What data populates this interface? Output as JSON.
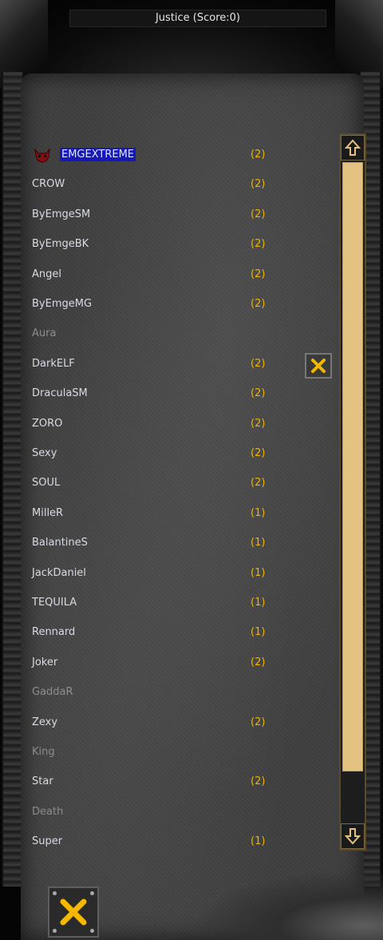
{
  "window": {
    "title": "Justice (Score:0)"
  },
  "players": [
    {
      "name": "EMGEXTREME",
      "count": "(2)",
      "selected": true,
      "active": true
    },
    {
      "name": "CROW",
      "count": "(2)",
      "active": true
    },
    {
      "name": "ByEmgeSM",
      "count": "(2)",
      "active": true
    },
    {
      "name": "ByEmgeBK",
      "count": "(2)",
      "active": true
    },
    {
      "name": "Angel",
      "count": "(2)",
      "active": true
    },
    {
      "name": "ByEmgeMG",
      "count": "(2)",
      "active": true
    },
    {
      "name": "Aura",
      "count": "",
      "active": false
    },
    {
      "name": "DarkELF",
      "count": "(2)",
      "active": true
    },
    {
      "name": "DraculaSM",
      "count": "(2)",
      "active": true
    },
    {
      "name": "ZORO",
      "count": "(2)",
      "active": true
    },
    {
      "name": "Sexy",
      "count": "(2)",
      "active": true
    },
    {
      "name": "SOUL",
      "count": "(2)",
      "active": true
    },
    {
      "name": "MilleR",
      "count": "(1)",
      "active": true
    },
    {
      "name": "BalantineS",
      "count": "(1)",
      "active": true
    },
    {
      "name": "JackDaniel",
      "count": "(1)",
      "active": true
    },
    {
      "name": "TEQUILA",
      "count": "(1)",
      "active": true
    },
    {
      "name": "Rennard",
      "count": "(1)",
      "active": true
    },
    {
      "name": "Joker",
      "count": "(2)",
      "active": true
    },
    {
      "name": "GaddaR",
      "count": "",
      "active": false
    },
    {
      "name": "Zexy",
      "count": "(2)",
      "active": true
    },
    {
      "name": "King",
      "count": "",
      "active": false
    },
    {
      "name": "Star",
      "count": "(2)",
      "active": true
    },
    {
      "name": "Death",
      "count": "",
      "active": false
    },
    {
      "name": "Super",
      "count": "(1)",
      "active": true
    }
  ],
  "icons": {
    "selected_player": "devil-icon",
    "scroll_up": "arrow-up-icon",
    "scroll_down": "arrow-down-icon",
    "close": "close-icon"
  },
  "colors": {
    "name_text": "#d8dbe3",
    "inactive_text": "#8d8d8d",
    "count_text": "#f0b400",
    "selection_bg": "#1818b8",
    "scroll_thumb": "#e3c282"
  },
  "scroll": {
    "thumb_fraction": 0.87
  }
}
